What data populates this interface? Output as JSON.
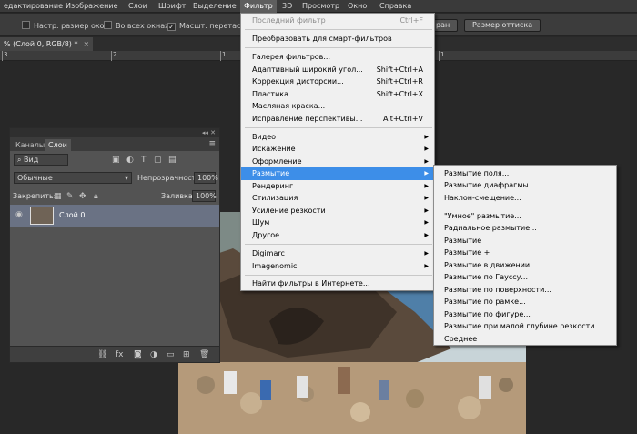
{
  "menubar": {
    "items": [
      "едактирование",
      "Изображение",
      "Слои",
      "Шрифт",
      "Выделение",
      "Фильтр",
      "3D",
      "Просмотр",
      "Окно",
      "Справка"
    ],
    "active_index": 5
  },
  "options": {
    "resize_windows": "Настр. размер окон",
    "all_windows": "Во всех окнах",
    "scale_label": "Масшт. перетаскив",
    "fit_btn": "ран",
    "print_size_btn": "Размер оттиска"
  },
  "document_tab": {
    "label": "% (Слой 0, RGB/8) *",
    "close": "×"
  },
  "ruler": {
    "numbers": [
      "3",
      "2",
      "1",
      "0",
      "1"
    ]
  },
  "layers_panel": {
    "collapse": "◂◂ ✕",
    "tabs": [
      "Каналы",
      "Слои"
    ],
    "filter_kind": "Вид",
    "blend_mode": "Обычные",
    "opacity_label": "Непрозрачность:",
    "opacity_value": "100%",
    "lock_label": "Закрепить:",
    "fill_label": "Заливка:",
    "fill_value": "100%",
    "layer_name": "Слой 0"
  },
  "filter_menu": {
    "items": [
      {
        "label": "Последний фильтр",
        "shortcut": "Ctrl+F",
        "disabled": true
      },
      {
        "label": "Преобразовать для смарт-фильтров",
        "shortcut": ""
      },
      {
        "label": "Галерея фильтров...",
        "shortcut": ""
      },
      {
        "label": "Адаптивный широкий угол...",
        "shortcut": "Shift+Ctrl+A"
      },
      {
        "label": "Коррекция дисторсии...",
        "shortcut": "Shift+Ctrl+R"
      },
      {
        "label": "Пластика...",
        "shortcut": "Shift+Ctrl+X"
      },
      {
        "label": "Масляная краска...",
        "shortcut": ""
      },
      {
        "label": "Исправление перспективы...",
        "shortcut": "Alt+Ctrl+V"
      },
      {
        "label": "Видео",
        "shortcut": ""
      },
      {
        "label": "Искажение",
        "shortcut": ""
      },
      {
        "label": "Оформление",
        "shortcut": ""
      },
      {
        "label": "Размытие",
        "shortcut": ""
      },
      {
        "label": "Рендеринг",
        "shortcut": ""
      },
      {
        "label": "Стилизация",
        "shortcut": ""
      },
      {
        "label": "Усиление резкости",
        "shortcut": ""
      },
      {
        "label": "Шум",
        "shortcut": ""
      },
      {
        "label": "Другое",
        "shortcut": ""
      },
      {
        "label": "Digimarc",
        "shortcut": ""
      },
      {
        "label": "Imagenomic",
        "shortcut": ""
      },
      {
        "label": "Найти фильтры в Интернете...",
        "shortcut": ""
      }
    ]
  },
  "blur_submenu": {
    "items": [
      "Размытие поля...",
      "Размытие диафрагмы...",
      "Наклон-смещение...",
      "\"Умное\" размытие...",
      "Радиальное размытие...",
      "Размытие",
      "Размытие +",
      "Размытие в движении...",
      "Размытие по Гауссу...",
      "Размытие по поверхности...",
      "Размытие по рамке...",
      "Размытие по фигуре...",
      "Размытие при малой глубине резкости...",
      "Среднее"
    ]
  },
  "colors": {
    "highlight": "#3d8ee8",
    "menu_bg": "#f0f0f0",
    "ui_dark": "#282828"
  }
}
